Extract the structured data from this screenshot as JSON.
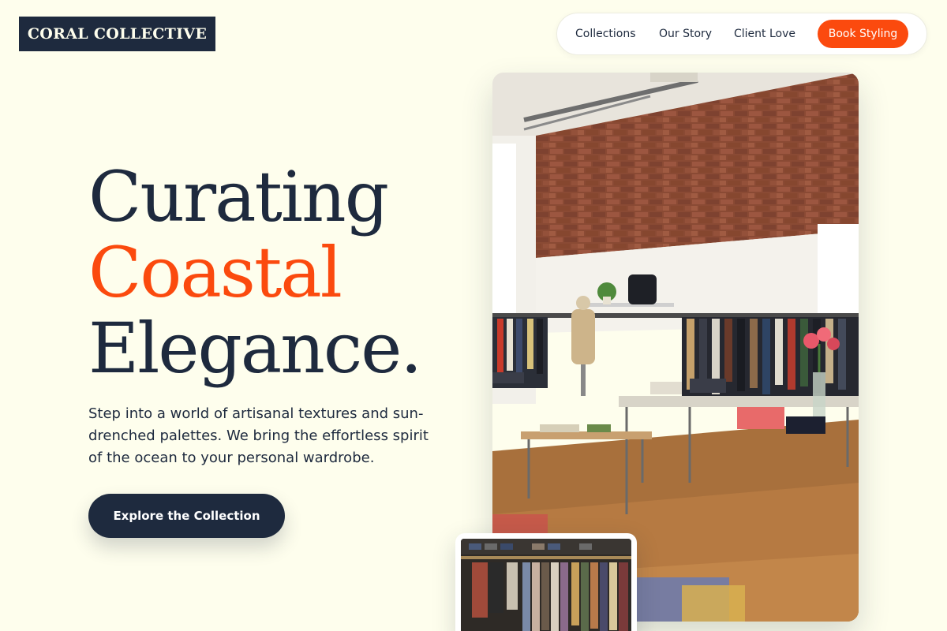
{
  "brand": {
    "name": "CORAL COLLECTIVE"
  },
  "nav": {
    "links": [
      "Collections",
      "Our Story",
      "Client Love"
    ],
    "cta_label": "Book Styling"
  },
  "hero": {
    "headline": [
      "Curating",
      "Coastal",
      "Elegance."
    ],
    "subtext": "Step into a world of artisanal textures and sun-drenched palettes. We bring the effortless spirit of the ocean to your personal wardrobe.",
    "cta_label": "Explore the Collection"
  },
  "colors": {
    "background": "#fefeed",
    "navy": "#1e2a3e",
    "coral": "#fb4a0e"
  },
  "images": {
    "main": "boutique-interior-photo",
    "thumb": "clothing-rack-photo"
  }
}
